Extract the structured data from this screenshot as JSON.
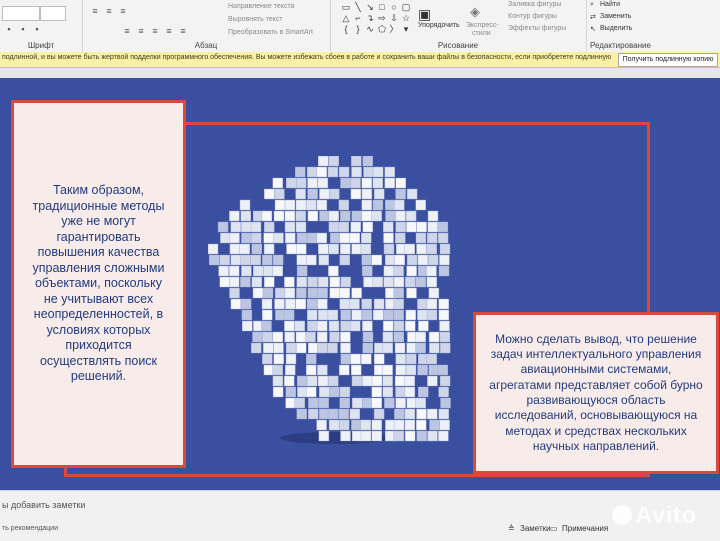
{
  "ribbon": {
    "font_group_label": "Шрифт",
    "paragraph_group_label": "Абзац",
    "text_direction": "Направление текста",
    "align_text": "Выровнять текст",
    "smartart": "Преобразовать в SmartArt",
    "drawing_group_label": "Рисование",
    "arrange": "Упорядочить",
    "express_1": "Экспресс-",
    "express_2": "стили",
    "shape_fill": "Заливка фигуры",
    "shape_outline": "Контур фигуры",
    "shape_effects": "Эффекты фигуры",
    "find": "Найти",
    "replace": "Заменить",
    "select": "Выделить",
    "editing_group_label": "Редактирование"
  },
  "warning": {
    "message": "подлинной, и вы можете быть жертвой подделки программного обеспечения. Вы можете избежать сбоев в работе и сохранить ваши файлы в безопасности, если приобретете подлинную",
    "button": "Получить подлинную копию"
  },
  "slide": {
    "left_text": "Таким образом, традиционные методы уже не могут гарантировать повышения качества управления сложными объектами, поскольку не учитывают всех неопределенностей, в условиях которых приходится осуществлять поиск решений.",
    "right_text": "Можно сделать вывод, что решение задач интеллектуального управления авиационными системами, агрегатами представляет собой бурно развивающуюся область исследований, основывающуюся на методах и средствах нескольких научных направлений."
  },
  "status": {
    "notes_placeholder": "ы добавить заметки",
    "recommendations": "ть рекомендации",
    "notes_button": "Заметки",
    "comments_button": "Примечания"
  },
  "watermark": "Avito",
  "colors": {
    "slide_bg": "#3a4fa0",
    "accent_red": "#d94a3c",
    "text_box_bg": "#f7ecea",
    "text_color": "#233a80",
    "warning_bg": "#fbf0a6"
  }
}
